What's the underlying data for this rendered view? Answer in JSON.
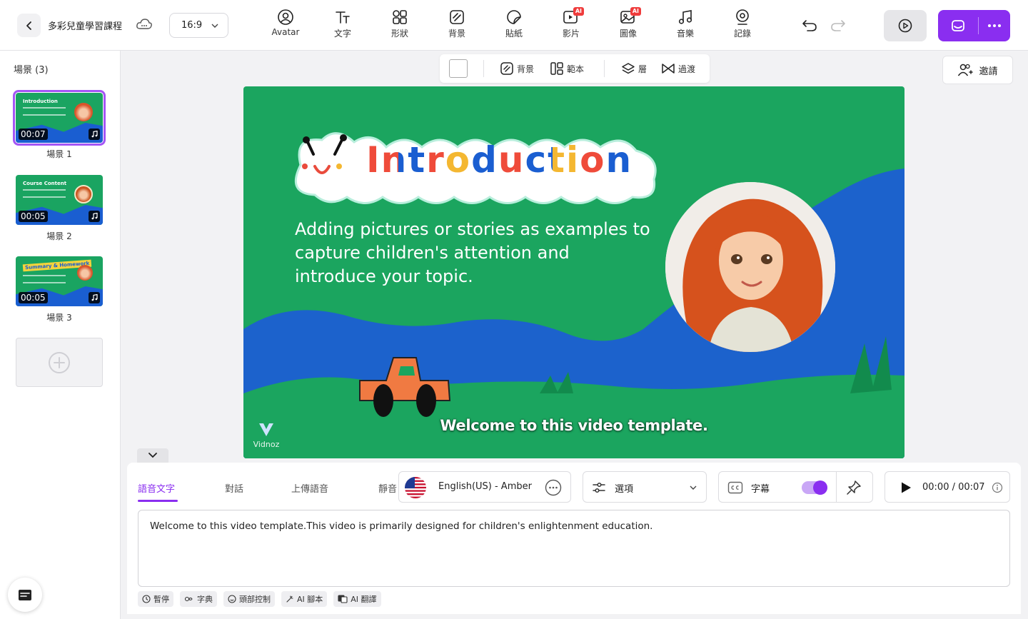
{
  "header": {
    "project_title": "多彩兒童學習課程",
    "aspect_ratio": "16:9",
    "tools": [
      {
        "label": "Avatar",
        "icon": "avatar-icon"
      },
      {
        "label": "文字",
        "icon": "text-icon"
      },
      {
        "label": "形狀",
        "icon": "shapes-icon"
      },
      {
        "label": "背景",
        "icon": "background-icon"
      },
      {
        "label": "貼紙",
        "icon": "sticker-icon"
      },
      {
        "label": "影片",
        "icon": "video-icon",
        "badge": "AI"
      },
      {
        "label": "圖像",
        "icon": "image-icon",
        "badge": "AI"
      },
      {
        "label": "音樂",
        "icon": "music-icon"
      },
      {
        "label": "記錄",
        "icon": "record-icon"
      }
    ],
    "accent_color": "#8a2ef0"
  },
  "sidebar": {
    "scene_count_label": "場景 (3)",
    "scenes": [
      {
        "label": "場景 1",
        "duration": "00:07",
        "thumb_title": "Introduction"
      },
      {
        "label": "場景 2",
        "duration": "00:05",
        "thumb_title": "Course Content"
      },
      {
        "label": "場景 3",
        "duration": "00:05",
        "thumb_title": "Summary & Homework"
      }
    ]
  },
  "canvas_toolbar": {
    "background": "背景",
    "template": "範本",
    "layer": "層",
    "transition": "過渡"
  },
  "invite_label": "邀請",
  "slide": {
    "title": "Introduction",
    "body": "Adding pictures or stories as examples to capture children's attention and introduce your topic.",
    "subtitle": "Welcome to this video template.",
    "watermark": "Vidnoz",
    "bg_color": "#1ba55f"
  },
  "bottom": {
    "tabs": [
      "語音文字",
      "對話",
      "上傳語音",
      "靜音"
    ],
    "voice": "English(US) - Amber",
    "options": "選項",
    "captions": "字幕",
    "time": "00:00 / 00:07",
    "script": "Welcome to this video template.This video is primarily designed for children's enlightenment education.",
    "chips": [
      "暫停",
      "字典",
      "頭部控制",
      "AI 腳本",
      "AI 翻譯"
    ]
  }
}
